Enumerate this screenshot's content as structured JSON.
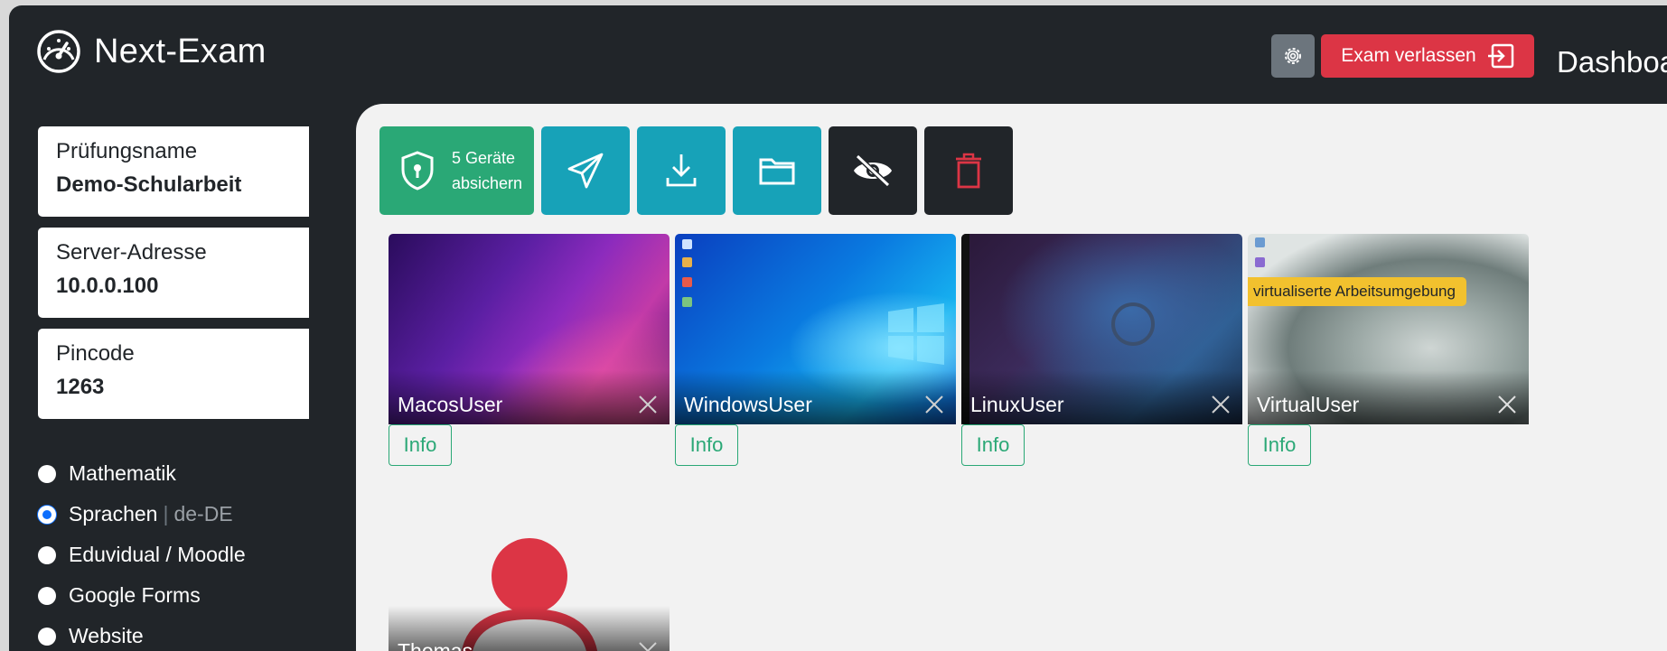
{
  "app": {
    "name": "Next-Exam",
    "dashboard_title": "Dashboard"
  },
  "header": {
    "exit_label": "Exam verlassen"
  },
  "sidebar": {
    "exam": {
      "label": "Prüfungsname",
      "value": "Demo-Schularbeit"
    },
    "server": {
      "label": "Server-Adresse",
      "value": "10.0.0.100"
    },
    "pin": {
      "label": "Pincode",
      "value": "1263"
    },
    "modes": [
      {
        "label": "Mathematik",
        "checked": false
      },
      {
        "label": "Sprachen",
        "suffix": "de-DE",
        "checked": true
      },
      {
        "label": "Eduvidual / Moodle",
        "checked": false
      },
      {
        "label": "Google Forms",
        "checked": false
      },
      {
        "label": "Website",
        "checked": false
      }
    ]
  },
  "toolbar": {
    "secure_line1": "5 Geräte",
    "secure_line2": "absichern"
  },
  "students": [
    {
      "name": "MacosUser",
      "info": "Info"
    },
    {
      "name": "WindowsUser",
      "info": "Info"
    },
    {
      "name": "LinuxUser",
      "info": "Info"
    },
    {
      "name": "VirtualUser",
      "info": "Info",
      "badge": "virtualiserte Arbeitsumgebung"
    },
    {
      "name": "Thomas"
    }
  ],
  "colors": {
    "sidebar_bg": "#212529",
    "success": "#2aa876",
    "info": "#17a2b8",
    "danger": "#dc3545",
    "secondary": "#6c757d",
    "warning": "#f2c12e"
  }
}
